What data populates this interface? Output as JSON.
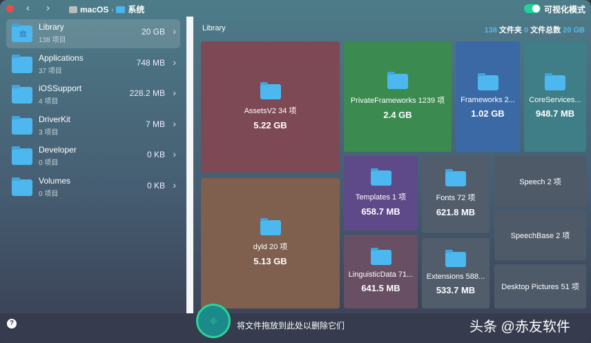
{
  "titlebar": {
    "breadcrumb": [
      "macOS",
      "系统"
    ],
    "toggle_label": "可视化模式",
    "toggle_on": true
  },
  "sidebar": {
    "items": [
      {
        "name": "Library",
        "count": "138 项目",
        "size": "20 GB",
        "selected": true
      },
      {
        "name": "Applications",
        "count": "37 项目",
        "size": "748 MB"
      },
      {
        "name": "iOSSupport",
        "count": "4 项目",
        "size": "228.2 MB"
      },
      {
        "name": "DriverKit",
        "count": "3 项目",
        "size": "7 MB"
      },
      {
        "name": "Developer",
        "count": "0 项目",
        "size": "0 KB"
      },
      {
        "name": "Volumes",
        "count": "0 项目",
        "size": "0 KB"
      }
    ]
  },
  "main": {
    "title": "Library",
    "stats": {
      "folders": "138",
      "folders_label": "文件夹",
      "files": "0",
      "files_label": "文件总数",
      "total": "20 GB"
    },
    "tiles": [
      {
        "name": "AssetsV2 34 项",
        "size": "5.22 GB",
        "color": "#7d4954"
      },
      {
        "name": "dyld 20 项",
        "size": "5.13 GB",
        "color": "#7f5f4e"
      },
      {
        "name": "PrivateFrameworks 1239 项",
        "size": "2.4 GB",
        "color": "#3b8a4f"
      },
      {
        "name": "Frameworks 2...",
        "size": "1.02 GB",
        "color": "#3a69a6"
      },
      {
        "name": "CoreServices...",
        "size": "948.7 MB",
        "color": "#3f7e86"
      },
      {
        "name": "Templates 1 项",
        "size": "658.7 MB",
        "color": "#5e4989"
      },
      {
        "name": "LinguisticData 71...",
        "size": "641.5 MB",
        "color": "#684f63"
      },
      {
        "name": "Fonts 72 项",
        "size": "621.8 MB",
        "color": "#525d6c"
      },
      {
        "name": "Extensions 588...",
        "size": "533.7 MB",
        "color": "#525d6c"
      },
      {
        "name": "Speech 2 项",
        "size": "",
        "color": "#4f5a69"
      },
      {
        "name": "SpeechBase 2 项",
        "size": "",
        "color": "#4f5a69"
      },
      {
        "name": "Desktop Pictures 51 项",
        "size": "",
        "color": "#4f5a69"
      }
    ]
  },
  "bottom": {
    "help": "?",
    "drop_text": "将文件拖放到此处以删除它们",
    "watermark": "头条 @赤友软件"
  }
}
